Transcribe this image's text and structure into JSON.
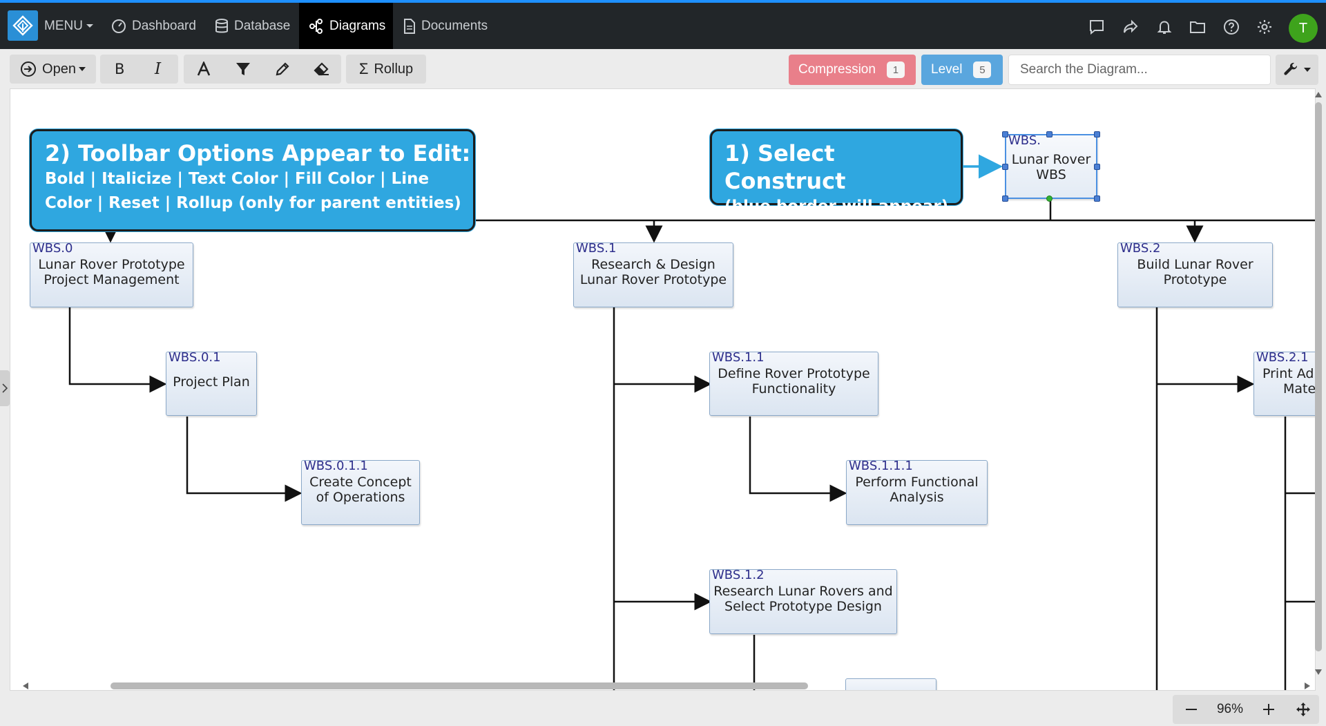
{
  "nav": {
    "menu_label": "MENU",
    "items": [
      {
        "label": "Dashboard"
      },
      {
        "label": "Database"
      },
      {
        "label": "Diagrams"
      },
      {
        "label": "Documents"
      }
    ],
    "avatar_letter": "T",
    "accent_color": "#1e90ff"
  },
  "toolbar": {
    "open_label": "Open",
    "rollup_label": "Rollup",
    "compression_label": "Compression",
    "compression_count": "1",
    "level_label": "Level",
    "level_count": "5",
    "search_placeholder": "Search the Diagram...",
    "compression_color": "#e97f8a",
    "level_color": "#5aa6de"
  },
  "callouts": {
    "toolbar_title": "2) Toolbar Options Appear to Edit:",
    "toolbar_line1": "Bold | Italicize | Text Color | Fill Color | Line",
    "toolbar_line2": "Color | Reset | Rollup (only for parent entities)",
    "select_title": "1) Select Construct",
    "select_line1": "(blue border will appear)"
  },
  "nodes": {
    "root": {
      "id": "WBS.",
      "line1": "Lunar Rover",
      "line2": "WBS"
    },
    "wbs0": {
      "id": "WBS.0",
      "line1": "Lunar Rover Prototype",
      "line2": "Project Management"
    },
    "wbs01": {
      "id": "WBS.0.1",
      "line1": "Project Plan"
    },
    "wbs011": {
      "id": "WBS.0.1.1",
      "line1": "Create Concept",
      "line2": "of Operations"
    },
    "wbs1": {
      "id": "WBS.1",
      "line1": "Research & Design",
      "line2": "Lunar Rover Prototype"
    },
    "wbs11": {
      "id": "WBS.1.1",
      "line1": "Define Rover Prototype",
      "line2": "Functionality"
    },
    "wbs111": {
      "id": "WBS.1.1.1",
      "line1": "Perform Functional",
      "line2": "Analysis"
    },
    "wbs12": {
      "id": "WBS.1.2",
      "line1": "Research Lunar Rovers and",
      "line2": "Select Prototype Design"
    },
    "wbs2": {
      "id": "WBS.2",
      "line1": "Build Lunar Rover",
      "line2": "Prototype"
    },
    "wbs21": {
      "id": "WBS.2.1",
      "line1": "Print Ad",
      "line2": "Mate"
    }
  },
  "zoom": {
    "value": "96%"
  }
}
